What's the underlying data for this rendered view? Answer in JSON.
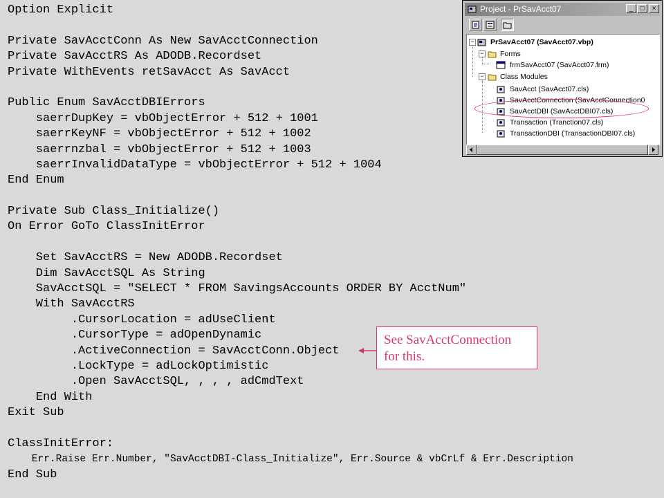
{
  "code_lines": [
    "Option Explicit",
    "",
    "Private SavAcctConn As New SavAcctConnection",
    "Private SavAcctRS As ADODB.Recordset",
    "Private WithEvents retSavAcct As SavAcct",
    "",
    "Public Enum SavAcctDBIErrors",
    "    saerrDupKey = vbObjectError + 512 + 1001",
    "    saerrKeyNF = vbObjectError + 512 + 1002",
    "    saerrnzbal = vbObjectError + 512 + 1003",
    "    saerrInvalidDataType = vbObjectError + 512 + 1004",
    "End Enum",
    "",
    "Private Sub Class_Initialize()",
    "On Error GoTo ClassInitError",
    "",
    "    Set SavAcctRS = New ADODB.Recordset",
    "    Dim SavAcctSQL As String",
    "    SavAcctSQL = \"SELECT * FROM SavingsAccounts ORDER BY AcctNum\"",
    "    With SavAcctRS",
    "         .CursorLocation = adUseClient",
    "         .CursorType = adOpenDynamic",
    "         .ActiveConnection = SavAcctConn.Object",
    "         .LockType = adLockOptimistic",
    "         .Open SavAcctSQL, , , , adCmdText",
    "    End With",
    "Exit Sub",
    "",
    "ClassInitError:",
    "    Err.Raise Err.Number, \"SavAcctDBI-Class_Initialize\", Err.Source & vbCrLf & Err.Description",
    "End Sub"
  ],
  "project_window": {
    "title": "Project - PrSavAcct07",
    "buttons": {
      "minimize": "_",
      "maximize": "□",
      "close": "×"
    },
    "tree": {
      "project": "PrSavAcct07 (SavAcct07.vbp)",
      "forms_folder": "Forms",
      "forms": [
        "frmSavAcct07 (SavAcct07.frm)"
      ],
      "modules_folder": "Class Modules",
      "modules": [
        "SavAcct (SavAcct07.cls)",
        "SavAcctConnection (SavAcctConnection0",
        "SavAcctDBI (SavAcctDBI07.cls)",
        "Transaction (Tranction07.cls)",
        "TransactionDBI (TransactionDBI07.cls)"
      ],
      "highlighted_module": "SavAcctDBI (SavAcctDBI07.cls)"
    },
    "icons": [
      "view-code-icon",
      "view-object-icon",
      "toggle-folders-icon"
    ]
  },
  "callout": {
    "line1": "See SavAcctConnection",
    "line2": "for this."
  },
  "colors": {
    "background": "#d9d9d9",
    "annotation": "#d4386a",
    "titlebar": "#808080"
  }
}
